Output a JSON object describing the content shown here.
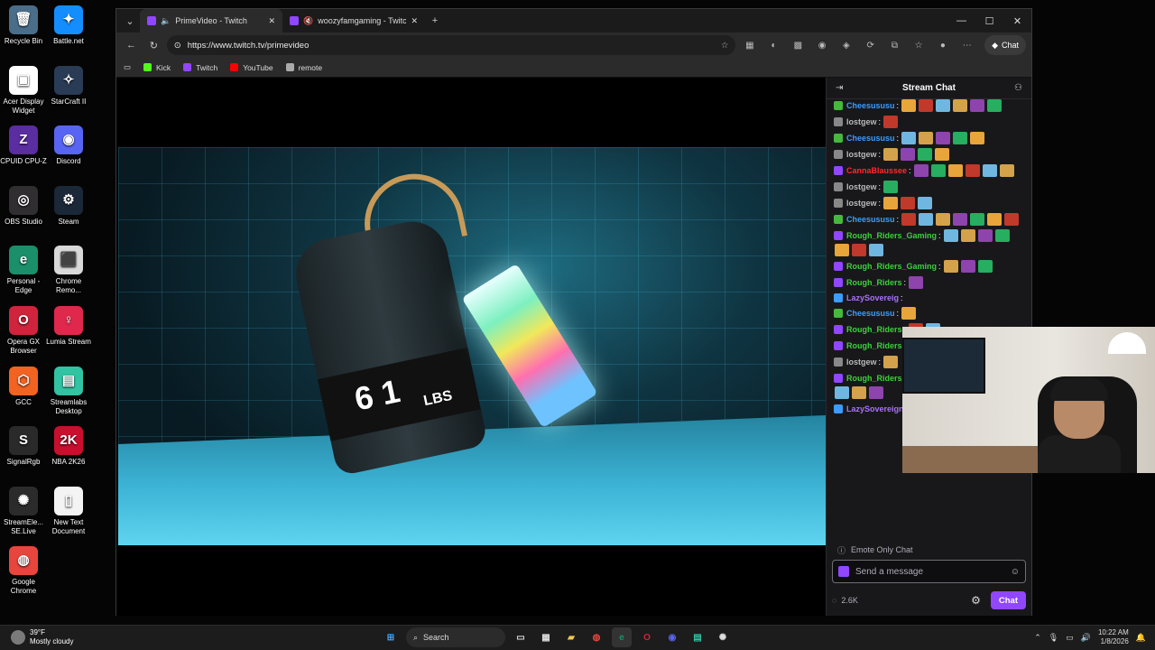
{
  "desktop": {
    "icons": [
      {
        "label": "Recycle Bin",
        "glyph": "🗑",
        "color": "#4a6e8a"
      },
      {
        "label": "Battle.net",
        "glyph": "✦",
        "color": "#148eff"
      },
      {
        "label": "Acer Display Widget",
        "glyph": "▣",
        "color": "#ffffff"
      },
      {
        "label": "StarCraft II",
        "glyph": "✧",
        "color": "#2a3b55"
      },
      {
        "label": "CPUID CPU-Z",
        "glyph": "Z",
        "color": "#5a2da0"
      },
      {
        "label": "Discord",
        "glyph": "◉",
        "color": "#5865f2"
      },
      {
        "label": "OBS Studio",
        "glyph": "◎",
        "color": "#302e31"
      },
      {
        "label": "Steam",
        "glyph": "⚙",
        "color": "#1b2838"
      },
      {
        "label": "Personal - Edge",
        "glyph": "e",
        "color": "#1a8f6a"
      },
      {
        "label": "Chrome Remo...",
        "glyph": "⬛",
        "color": "#d9d9d9"
      },
      {
        "label": "Opera GX Browser",
        "glyph": "O",
        "color": "#d0243c"
      },
      {
        "label": "Lumia Stream",
        "glyph": "♀",
        "color": "#e0284d"
      },
      {
        "label": "GCC",
        "glyph": "⬡",
        "color": "#f26322"
      },
      {
        "label": "Streamlabs Desktop",
        "glyph": "▤",
        "color": "#31c3a2"
      },
      {
        "label": "SignalRgb",
        "glyph": "S",
        "color": "#2a2a2a"
      },
      {
        "label": "NBA 2K26",
        "glyph": "2K",
        "color": "#c8102e"
      },
      {
        "label": "StreamEle... SE.Live",
        "glyph": "✺",
        "color": "#2b2b2b"
      },
      {
        "label": "New Text Document",
        "glyph": "▯",
        "color": "#f4f4f4"
      },
      {
        "label": "Google Chrome",
        "glyph": "◍",
        "color": "#e8453c"
      }
    ]
  },
  "browser": {
    "tabs": [
      {
        "label": "PrimeVideo - Twitch",
        "active": true
      },
      {
        "label": "woozyfamgaming - Twitch",
        "active": false
      }
    ],
    "new_tab": "+",
    "url": "https://www.twitch.tv/primevideo",
    "chat_button": "Chat",
    "favorites": [
      {
        "label": "Kick",
        "color": "#53fc18"
      },
      {
        "label": "Twitch",
        "color": "#9146ff"
      },
      {
        "label": "YouTube",
        "color": "#ff0000"
      },
      {
        "label": "remote",
        "color": "#aaaaaa"
      }
    ]
  },
  "video": {
    "weight_number": "6 1",
    "weight_unit": "LBS"
  },
  "chat": {
    "title": "Stream Chat",
    "messages": [
      {
        "user": "Cheesususu",
        "color": "#3c9cff",
        "badge": "#46b83d",
        "emotes": 6
      },
      {
        "user": "lostgew",
        "color": "#b9b9b9",
        "badge": "#888888",
        "emotes": 1
      },
      {
        "user": "Cheesususu",
        "color": "#3c9cff",
        "badge": "#46b83d",
        "emotes": 5
      },
      {
        "user": "lostgew",
        "color": "#b9b9b9",
        "badge": "#888888",
        "emotes": 4
      },
      {
        "user": "CannaBlaussee",
        "color": "#ff2a2a",
        "badge": "#9146ff",
        "emotes": 6
      },
      {
        "user": "lostgew",
        "color": "#b9b9b9",
        "badge": "#888888",
        "emotes": 1
      },
      {
        "user": "lostgew",
        "color": "#b9b9b9",
        "badge": "#888888",
        "emotes": 3
      },
      {
        "user": "Cheesususu",
        "color": "#3c9cff",
        "badge": "#46b83d",
        "emotes": 7
      },
      {
        "user": "Rough_Riders_Gaming",
        "color": "#3bd13b",
        "badge": "#9146ff",
        "emotes": 7
      },
      {
        "user": "Rough_Riders_Gaming",
        "color": "#3bd13b",
        "badge": "#9146ff",
        "emotes": 3
      },
      {
        "user": "Rough_Riders",
        "color": "#3bd13b",
        "badge": "#9146ff",
        "emotes": 1
      },
      {
        "user": "LazySovereig",
        "color": "#a970ff",
        "badge": "#3c9cff",
        "emotes": 0
      },
      {
        "user": "Cheesususu",
        "color": "#3c9cff",
        "badge": "#46b83d",
        "emotes": 1
      },
      {
        "user": "Rough_Riders",
        "color": "#3bd13b",
        "badge": "#9146ff",
        "emotes": 2
      },
      {
        "user": "Rough_Riders",
        "color": "#3bd13b",
        "badge": "#9146ff",
        "emotes": 1
      },
      {
        "user": "lostgew",
        "color": "#b9b9b9",
        "badge": "#888888",
        "emotes": 1
      },
      {
        "user": "Rough_Riders_Gaming",
        "color": "#3bd13b",
        "badge": "#9146ff",
        "emotes": 7
      },
      {
        "user": "LazySovereignOfGaming",
        "color": "#a970ff",
        "badge": "#3c9cff",
        "emotes": 3
      }
    ],
    "emote_only": "Emote Only Chat",
    "input_placeholder": "Send a message",
    "viewer_count": "2.6K",
    "send_label": "Chat"
  },
  "taskbar": {
    "temperature": "39°F",
    "weather": "Mostly cloudy",
    "search_label": "Search",
    "time": "10:22 AM",
    "date": "1/8/2026"
  }
}
